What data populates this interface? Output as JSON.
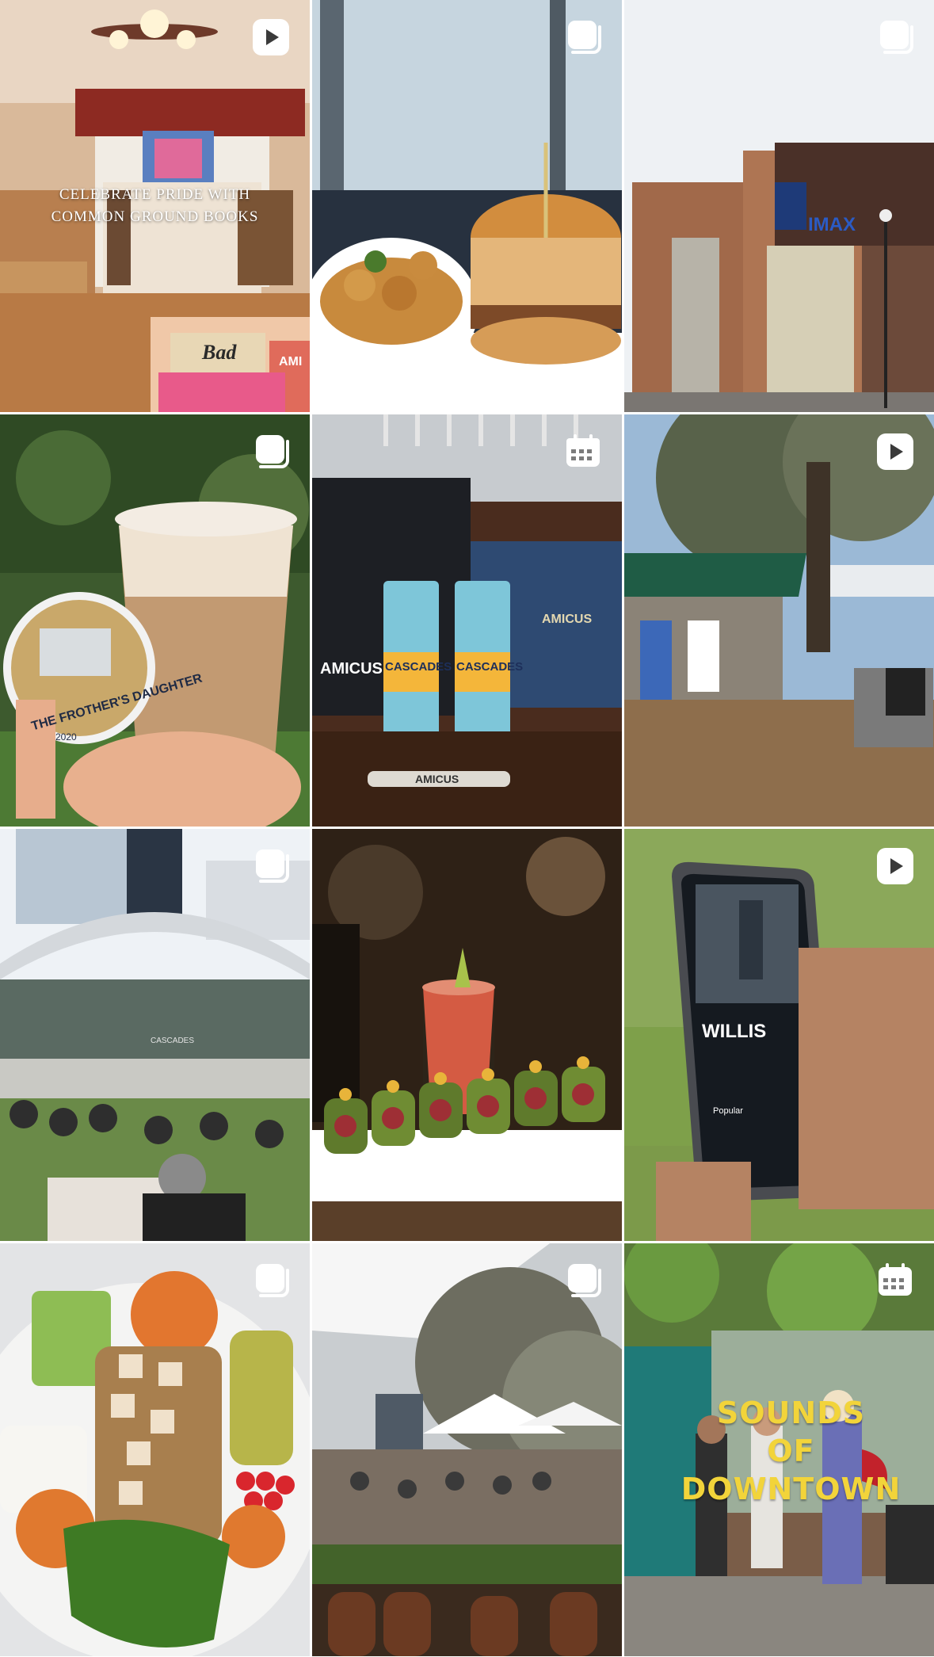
{
  "grid": {
    "posts": [
      {
        "type": "reel",
        "overlay_line1": "CELEBRATE PRIDE WITH",
        "overlay_line2": "COMMON GROUND BOOKS",
        "book1": "Bad",
        "book2": "AMI"
      },
      {
        "type": "carousel"
      },
      {
        "type": "carousel",
        "sign": "IMAX"
      },
      {
        "type": "carousel",
        "sticker_text": "THE FROTHER'S DAUGHTER",
        "sticker_year": "2020"
      },
      {
        "type": "event",
        "brand": "AMICUS",
        "can_label": "CASCADES",
        "stick_label": "AMICUS"
      },
      {
        "type": "reel"
      },
      {
        "type": "carousel",
        "stage_sign": "CASCADES"
      },
      {
        "type": "carousel"
      },
      {
        "type": "reel",
        "artist": "WILLIS",
        "popular": "Popular"
      },
      {
        "type": "carousel"
      },
      {
        "type": "carousel"
      },
      {
        "type": "event",
        "title_line1": "SOUNDS",
        "title_line2": "OF",
        "title_line3": "DOWNTOWN"
      }
    ]
  },
  "icons": {
    "reel": "reel-icon",
    "carousel": "carousel-icon",
    "event": "calendar-icon"
  }
}
